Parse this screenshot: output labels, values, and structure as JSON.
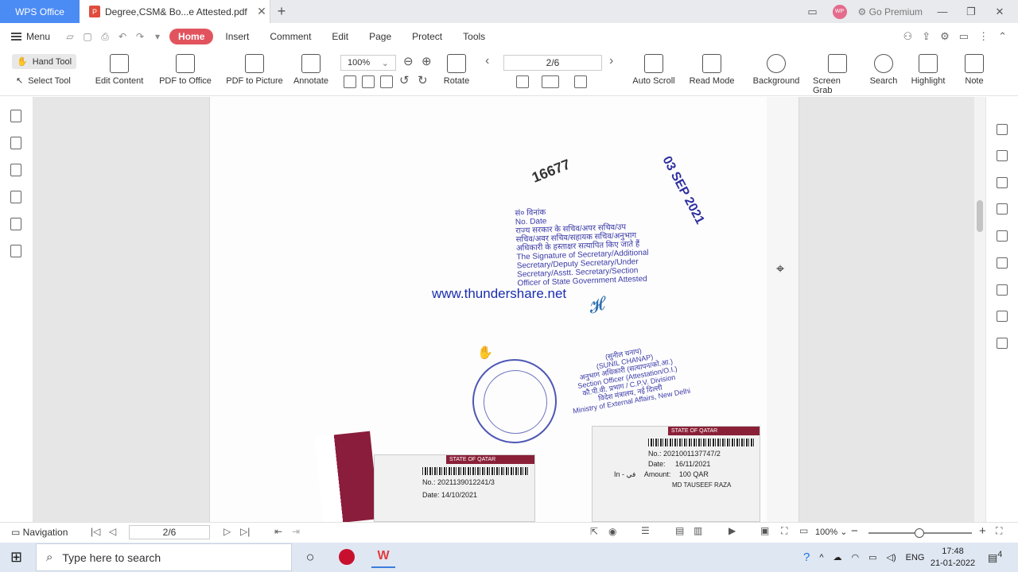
{
  "titlebar": {
    "app_tab": "WPS Office",
    "doc_tab": "Degree,CSM& Bo...e Attested.pdf",
    "avatar_initials": "WP",
    "go_premium": "Go Premium"
  },
  "menubar": {
    "menu": "Menu",
    "tabs": [
      "Home",
      "Insert",
      "Comment",
      "Edit",
      "Page",
      "Protect",
      "Tools"
    ]
  },
  "toolbar": {
    "hand_tool": "Hand Tool",
    "select_tool": "Select Tool",
    "edit_content": "Edit Content",
    "pdf_to_office": "PDF to Office",
    "pdf_to_picture": "PDF to Picture",
    "annotate": "Annotate",
    "zoom": "100%",
    "rotate": "Rotate",
    "page": "2/6",
    "auto_scroll": "Auto Scroll",
    "read_mode": "Read Mode",
    "background": "Background",
    "screen_grab": "Screen Grab",
    "search": "Search",
    "highlight": "Highlight",
    "note": "Note"
  },
  "document": {
    "stamp_number": "16677",
    "stamp_date": "03 SEP 2021",
    "stamp_lines": [
      "सं० विनांक",
      "No. Date",
      "राज्य सरकार के सचिव/अपर सचिव/उप",
      "सचिव/अवर सचिव/सहायक सचिव/अनुभाग",
      "अधिकारी के हस्ताक्षर सत्यापित किए जाते हैं",
      "The Signature of Secretary/Additional",
      "Secretary/Deputy Secretary/Under",
      "Secretary/Asstt. Secretary/Section",
      "Officer of State Government Attested"
    ],
    "watermark": "www.thundershare.net",
    "officer_lines": [
      "(सुनील चनाप)",
      "(SUNIL CHANAP)",
      "अनुभाग अधिकारी (सत्यापन/को.आ.)",
      "Section Officer (Attestation/O.I.)",
      "कौ.पी.वी. प्रभाग / C.P.V. Division",
      "विदेश मंत्रालय, नई दिल्ली",
      "Ministry of External Affairs, New Delhi"
    ],
    "sticker_left": {
      "header": "STATE OF QATAR",
      "no": "No.: 2021139012241/3",
      "date": "Date: 14/10/2021"
    },
    "sticker_right": {
      "header": "STATE OF QATAR",
      "no": "No.: 2021001137747/2",
      "date_label": "Date:",
      "date": "16/11/2021",
      "amount_label": "Amount:",
      "amount": "100 QAR",
      "name": "MD TAUSEEF RAZA",
      "in_label": "In - في"
    }
  },
  "statusbar": {
    "navigation": "Navigation",
    "page": "2/6",
    "zoom": "100%"
  },
  "taskbar": {
    "search_placeholder": "Type here to search",
    "lang": "ENG",
    "time": "17:48",
    "date": "21-01-2022",
    "notif_count": "4"
  }
}
